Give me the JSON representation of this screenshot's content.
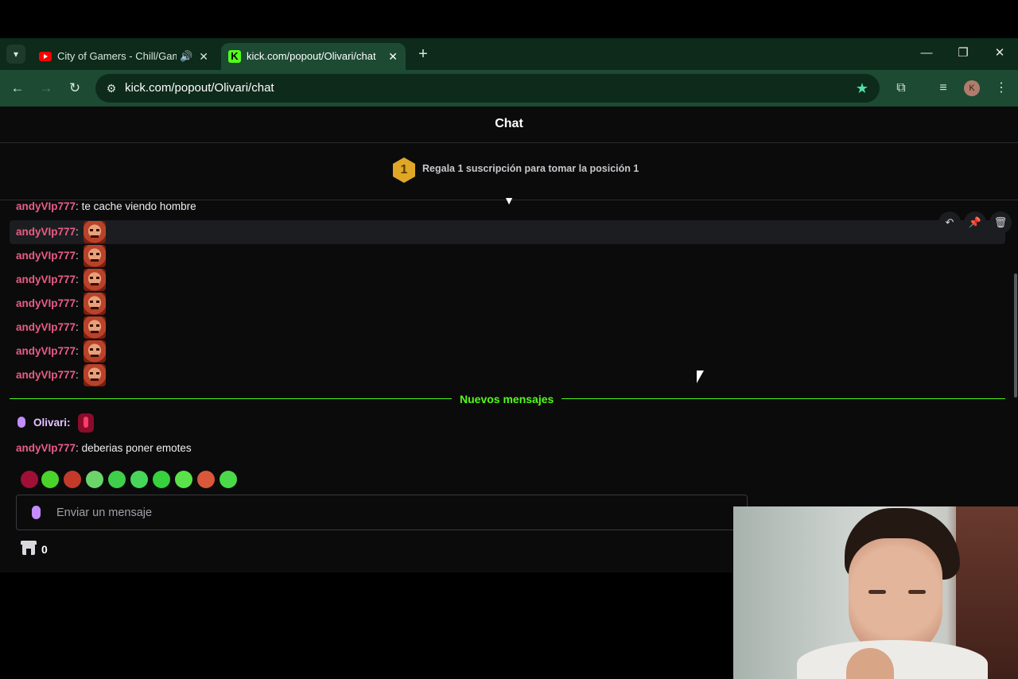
{
  "browser": {
    "tabs": [
      {
        "title": "City of Gamers - Chill/Gaming",
        "audio_icon": "speaker-icon",
        "favicon": "youtube-icon"
      },
      {
        "title": "kick.com/popout/Olivari/chat",
        "favicon": "kick-icon"
      }
    ],
    "url": "kick.com/popout/Olivari/chat",
    "profile_initial": "K"
  },
  "chat": {
    "header_title": "Chat",
    "sub_prompt": "Regala 1 suscripción para tomar la posición 1",
    "sub_rank": "1",
    "partial_message": {
      "user": "andyVIp777",
      "text": "te cache viendo hombre"
    },
    "emote_messages": [
      {
        "user": "andyVIp777"
      },
      {
        "user": "andyVIp777"
      },
      {
        "user": "andyVIp777"
      },
      {
        "user": "andyVIp777"
      },
      {
        "user": "andyVIp777"
      },
      {
        "user": "andyVIp777"
      },
      {
        "user": "andyVIp777"
      }
    ],
    "new_messages_label": "Nuevos mensajes",
    "olivari_message": {
      "user": "Olivari"
    },
    "last_message": {
      "user": "andyVIp777",
      "text": "deberias poner emotes"
    },
    "input_placeholder": "Enviar un mensaje",
    "points_count": "0"
  },
  "colors": {
    "accent": "#53fc18",
    "username": "#e95d86",
    "background": "#0b0b0c"
  }
}
